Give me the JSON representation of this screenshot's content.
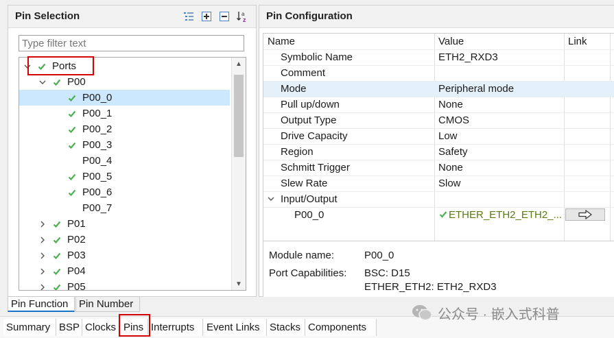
{
  "pin_selection": {
    "title": "Pin Selection",
    "filter_placeholder": "Type filter text",
    "toolbar_icons": [
      "collapse-all-icon",
      "expand-icon",
      "collapse-icon",
      "sort-az-icon"
    ],
    "tree": [
      {
        "label": "Ports",
        "level": 0,
        "expanded": true,
        "checked": true,
        "twisty": true
      },
      {
        "label": "P00",
        "level": 1,
        "expanded": true,
        "checked": true,
        "twisty": true
      },
      {
        "label": "P00_0",
        "level": 2,
        "checked": true,
        "selected": true
      },
      {
        "label": "P00_1",
        "level": 2,
        "checked": true
      },
      {
        "label": "P00_2",
        "level": 2,
        "checked": true
      },
      {
        "label": "P00_3",
        "level": 2,
        "checked": true
      },
      {
        "label": "P00_4",
        "level": 2,
        "checked": false
      },
      {
        "label": "P00_5",
        "level": 2,
        "checked": true
      },
      {
        "label": "P00_6",
        "level": 2,
        "checked": true
      },
      {
        "label": "P00_7",
        "level": 2,
        "checked": false
      },
      {
        "label": "P01",
        "level": 1,
        "expanded": false,
        "checked": true,
        "twisty": true
      },
      {
        "label": "P02",
        "level": 1,
        "expanded": false,
        "checked": true,
        "twisty": true
      },
      {
        "label": "P03",
        "level": 1,
        "expanded": false,
        "checked": true,
        "twisty": true
      },
      {
        "label": "P04",
        "level": 1,
        "expanded": false,
        "checked": true,
        "twisty": true
      },
      {
        "label": "P05",
        "level": 1,
        "expanded": false,
        "checked": true,
        "twisty": true
      }
    ]
  },
  "pin_configuration": {
    "title": "Pin Configuration",
    "headers": {
      "name": "Name",
      "value": "Value",
      "link": "Link"
    },
    "rows": [
      {
        "name": "Symbolic Name",
        "value": "ETH2_RXD3"
      },
      {
        "name": "Comment",
        "value": ""
      },
      {
        "name": "Mode",
        "value": "Peripheral mode",
        "selected": true
      },
      {
        "name": "Pull up/down",
        "value": "None"
      },
      {
        "name": "Output Type",
        "value": "CMOS"
      },
      {
        "name": "Drive Capacity",
        "value": "Low"
      },
      {
        "name": "Region",
        "value": "Safety"
      },
      {
        "name": "Schmitt Trigger",
        "value": "None"
      },
      {
        "name": "Slew Rate",
        "value": "Slow"
      },
      {
        "name": "Input/Output",
        "value": "",
        "group": true
      },
      {
        "name": "P00_0",
        "value": "ETHER_ETH2_ETH2_...",
        "sub": true,
        "checked": true,
        "link": true
      }
    ],
    "module": {
      "name_label": "Module name:",
      "name_value": "P00_0",
      "cap_label": "Port Capabilities:",
      "cap_values": [
        "BSC: D15",
        "ETHER_ETH2: ETH2_RXD3"
      ]
    }
  },
  "view_tabs": [
    "Pin Function",
    "Pin Number"
  ],
  "editor_tabs": [
    "Summary",
    "BSP",
    "Clocks",
    "Pins",
    "Interrupts",
    "Event Links",
    "Stacks",
    "Components"
  ],
  "watermark": "公众号 · 嵌入式科普",
  "colors": {
    "check": "#4caf50",
    "selection": "#cce8ff",
    "highlight": "#d40000",
    "tab_accent": "#1a73c8"
  }
}
